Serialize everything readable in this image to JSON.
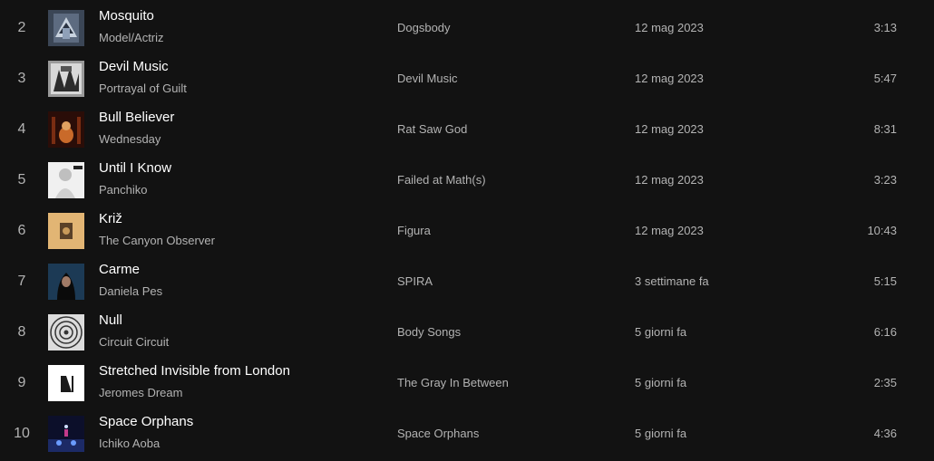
{
  "tracks": [
    {
      "index": "2",
      "title": "Mosquito",
      "artist": "Model/Actriz",
      "album": "Dogsbody",
      "date_added": "12 mag 2023",
      "duration": "3:13",
      "cover_icon": "album-cover-mosquito"
    },
    {
      "index": "3",
      "title": "Devil Music",
      "artist": "Portrayal of Guilt",
      "album": "Devil Music",
      "date_added": "12 mag 2023",
      "duration": "5:47",
      "cover_icon": "album-cover-devil-music"
    },
    {
      "index": "4",
      "title": "Bull Believer",
      "artist": "Wednesday",
      "album": "Rat Saw God",
      "date_added": "12 mag 2023",
      "duration": "8:31",
      "cover_icon": "album-cover-rat-saw-god"
    },
    {
      "index": "5",
      "title": "Until I Know",
      "artist": "Panchiko",
      "album": "Failed at Math(s)",
      "date_added": "12 mag 2023",
      "duration": "3:23",
      "cover_icon": "album-cover-failed-at-maths"
    },
    {
      "index": "6",
      "title": "Križ",
      "artist": "The Canyon Observer",
      "album": "Figura",
      "date_added": "12 mag 2023",
      "duration": "10:43",
      "cover_icon": "album-cover-figura"
    },
    {
      "index": "7",
      "title": "Carme",
      "artist": "Daniela Pes",
      "album": "SPIRA",
      "date_added": "3 settimane fa",
      "duration": "5:15",
      "cover_icon": "album-cover-spira"
    },
    {
      "index": "8",
      "title": "Null",
      "artist": "Circuit Circuit",
      "album": "Body Songs",
      "date_added": "5 giorni fa",
      "duration": "6:16",
      "cover_icon": "album-cover-body-songs"
    },
    {
      "index": "9",
      "title": "Stretched Invisible from London",
      "artist": "Jeromes Dream",
      "album": "The Gray In Between",
      "date_added": "5 giorni fa",
      "duration": "2:35",
      "cover_icon": "album-cover-gray-in-between"
    },
    {
      "index": "10",
      "title": "Space Orphans",
      "artist": "Ichiko Aoba",
      "album": "Space Orphans",
      "date_added": "5 giorni fa",
      "duration": "4:36",
      "cover_icon": "album-cover-space-orphans"
    }
  ],
  "colors": {
    "background": "#121212",
    "primary_text": "#ffffff",
    "secondary_text": "#b3b3b3"
  }
}
